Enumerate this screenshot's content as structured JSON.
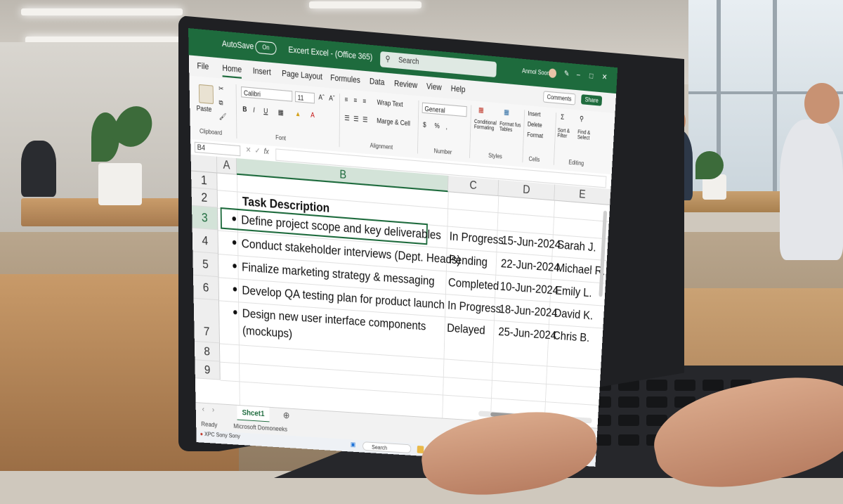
{
  "window": {
    "autosave_label": "AutoSave",
    "autosave_state": "On",
    "app_title": "Excert Excel - (Office 365)",
    "search_placeholder": "Search",
    "user_name": "Anmol Soom"
  },
  "tabs": [
    "File",
    "Home",
    "Insert",
    "Page Layout",
    "Formules",
    "Data",
    "Review",
    "View",
    "Help"
  ],
  "active_tab": "Home",
  "header_buttons": {
    "comments": "Comments",
    "share": "Share"
  },
  "ribbon": {
    "clipboard": {
      "paste": "Paste",
      "label": "Clipboard"
    },
    "font": {
      "name": "Calibri",
      "size": "11",
      "bold": "B",
      "italic": "I",
      "underline": "U",
      "label": "Font"
    },
    "alignment": {
      "wrap_text": "Wrap Text",
      "merge": "Marge & Cell",
      "label": "Alignment"
    },
    "number": {
      "format": "General",
      "currency": "$",
      "percent": "%",
      "label": "Number"
    },
    "styles": {
      "conditional": "Conditional Formating",
      "format_table": "Format fus Tables",
      "label": "Styles"
    },
    "cells": {
      "insert": "Insert",
      "delete": "Delete",
      "format": "Format",
      "label": "Cells"
    },
    "editing": {
      "sort": "Sort & Filter",
      "find": "Find & Select",
      "label": "Editing"
    }
  },
  "formula_bar": {
    "name_box": "B4",
    "fx": "fx"
  },
  "sheet": {
    "columns": [
      "A",
      "B",
      "C",
      "D",
      "E"
    ],
    "rows": [
      "1",
      "2",
      "3",
      "4",
      "5",
      "6",
      "7",
      "8",
      "9"
    ],
    "header": "Task Description",
    "tasks": [
      {
        "task": "Define project scope and key deliverables",
        "status": "In Progress",
        "date": "15-Jun-2024",
        "owner": "Sarah J."
      },
      {
        "task": "Conduct stakeholder interviews (Dept. Heads)",
        "status": "Pending",
        "date": "22-Jun-2024",
        "owner": "Michael R."
      },
      {
        "task": "Finalize marketing strategy & messaging",
        "status": "Completed",
        "date": "10-Jun-2024",
        "owner": "Emily L."
      },
      {
        "task": "Develop QA testing plan for product launch",
        "status": "In Progress",
        "date": "18-Jun-2024",
        "owner": "David K."
      },
      {
        "task": "Design new user interface components",
        "task_line2": "(mockups)",
        "status": "Delayed",
        "date": "25-Jun-2024",
        "owner": "Chris B."
      }
    ]
  },
  "sheet_tab": "Shcet1",
  "status": {
    "ready": "Ready",
    "account": "Microsoft Domoneeks"
  },
  "taskbar": {
    "search": "Search",
    "notif_title": "XPC",
    "notif_sub": "Sony Sony"
  },
  "colors": {
    "excel_green": "#1e6b3d"
  }
}
